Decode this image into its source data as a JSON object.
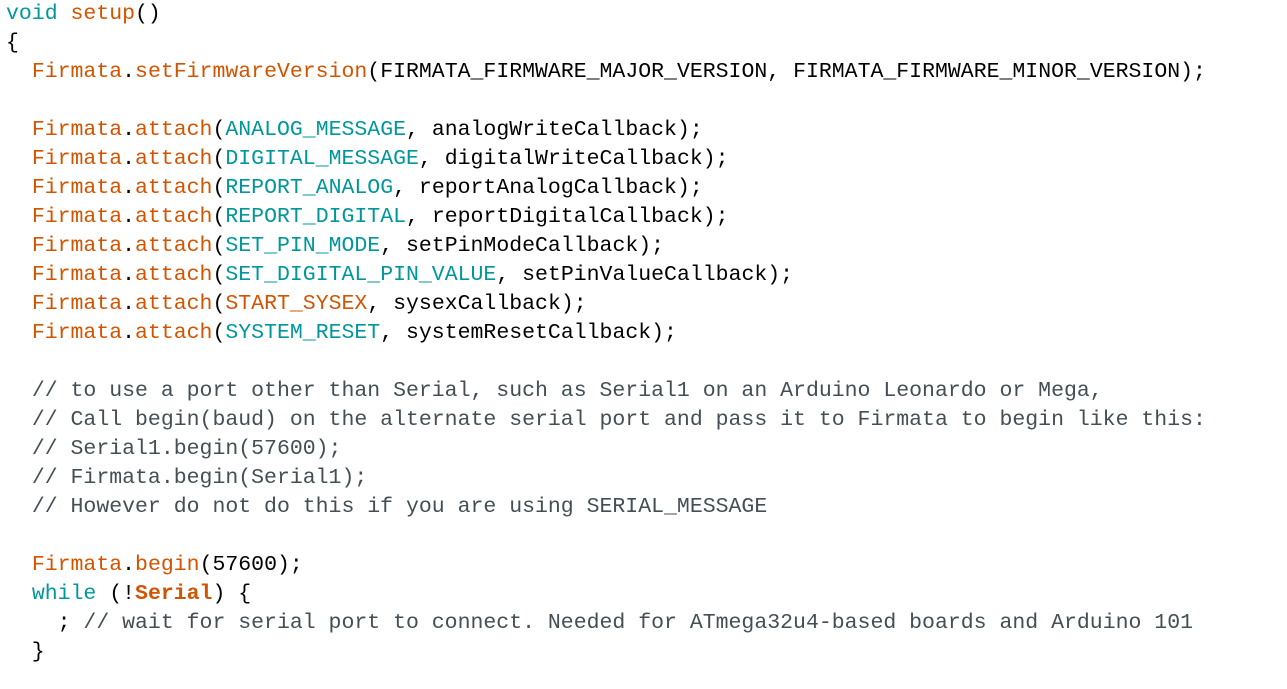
{
  "colors": {
    "background": "#ffffff",
    "text": "#000000",
    "keyword": "#00979C",
    "function": "#D35400",
    "constant": "#00979C",
    "comment": "#434F54"
  },
  "code_lines": [
    [
      {
        "t": "void",
        "c": "keyword"
      },
      {
        "t": " "
      },
      {
        "t": "setup",
        "c": "func"
      },
      {
        "t": "()"
      }
    ],
    [
      {
        "t": "{"
      }
    ],
    [
      {
        "t": "  "
      },
      {
        "t": "Firmata",
        "c": "func"
      },
      {
        "t": "."
      },
      {
        "t": "setFirmwareVersion",
        "c": "func"
      },
      {
        "t": "(FIRMATA_FIRMWARE_MAJOR_VERSION, FIRMATA_FIRMWARE_MINOR_VERSION);"
      }
    ],
    [],
    [
      {
        "t": "  "
      },
      {
        "t": "Firmata",
        "c": "func"
      },
      {
        "t": "."
      },
      {
        "t": "attach",
        "c": "func"
      },
      {
        "t": "("
      },
      {
        "t": "ANALOG_MESSAGE",
        "c": "const"
      },
      {
        "t": ", analogWriteCallback);"
      }
    ],
    [
      {
        "t": "  "
      },
      {
        "t": "Firmata",
        "c": "func"
      },
      {
        "t": "."
      },
      {
        "t": "attach",
        "c": "func"
      },
      {
        "t": "("
      },
      {
        "t": "DIGITAL_MESSAGE",
        "c": "const"
      },
      {
        "t": ", digitalWriteCallback);"
      }
    ],
    [
      {
        "t": "  "
      },
      {
        "t": "Firmata",
        "c": "func"
      },
      {
        "t": "."
      },
      {
        "t": "attach",
        "c": "func"
      },
      {
        "t": "("
      },
      {
        "t": "REPORT_ANALOG",
        "c": "const"
      },
      {
        "t": ", reportAnalogCallback);"
      }
    ],
    [
      {
        "t": "  "
      },
      {
        "t": "Firmata",
        "c": "func"
      },
      {
        "t": "."
      },
      {
        "t": "attach",
        "c": "func"
      },
      {
        "t": "("
      },
      {
        "t": "REPORT_DIGITAL",
        "c": "const"
      },
      {
        "t": ", reportDigitalCallback);"
      }
    ],
    [
      {
        "t": "  "
      },
      {
        "t": "Firmata",
        "c": "func"
      },
      {
        "t": "."
      },
      {
        "t": "attach",
        "c": "func"
      },
      {
        "t": "("
      },
      {
        "t": "SET_PIN_MODE",
        "c": "const"
      },
      {
        "t": ", setPinModeCallback);"
      }
    ],
    [
      {
        "t": "  "
      },
      {
        "t": "Firmata",
        "c": "func"
      },
      {
        "t": "."
      },
      {
        "t": "attach",
        "c": "func"
      },
      {
        "t": "("
      },
      {
        "t": "SET_DIGITAL_PIN_VALUE",
        "c": "const"
      },
      {
        "t": ", setPinValueCallback);"
      }
    ],
    [
      {
        "t": "  "
      },
      {
        "t": "Firmata",
        "c": "func"
      },
      {
        "t": "."
      },
      {
        "t": "attach",
        "c": "func"
      },
      {
        "t": "("
      },
      {
        "t": "START_SYSEX",
        "c": "func"
      },
      {
        "t": ", sysexCallback);"
      }
    ],
    [
      {
        "t": "  "
      },
      {
        "t": "Firmata",
        "c": "func"
      },
      {
        "t": "."
      },
      {
        "t": "attach",
        "c": "func"
      },
      {
        "t": "("
      },
      {
        "t": "SYSTEM_RESET",
        "c": "const"
      },
      {
        "t": ", systemResetCallback);"
      }
    ],
    [],
    [
      {
        "t": "  "
      },
      {
        "t": "// to use a port other than Serial, such as Serial1 on an Arduino Leonardo or Mega,",
        "c": "comment"
      }
    ],
    [
      {
        "t": "  "
      },
      {
        "t": "// Call begin(baud) on the alternate serial port and pass it to Firmata to begin like this:",
        "c": "comment"
      }
    ],
    [
      {
        "t": "  "
      },
      {
        "t": "// Serial1.begin(57600);",
        "c": "comment"
      }
    ],
    [
      {
        "t": "  "
      },
      {
        "t": "// Firmata.begin(Serial1);",
        "c": "comment"
      }
    ],
    [
      {
        "t": "  "
      },
      {
        "t": "// However do not do this if you are using SERIAL_MESSAGE",
        "c": "comment"
      }
    ],
    [],
    [
      {
        "t": "  "
      },
      {
        "t": "Firmata",
        "c": "func"
      },
      {
        "t": "."
      },
      {
        "t": "begin",
        "c": "func"
      },
      {
        "t": "(57600);"
      }
    ],
    [
      {
        "t": "  "
      },
      {
        "t": "while",
        "c": "keyword"
      },
      {
        "t": " (!"
      },
      {
        "t": "Serial",
        "c": "bold-class"
      },
      {
        "t": ") {"
      }
    ],
    [
      {
        "t": "    ; "
      },
      {
        "t": "// wait for serial port to connect. Needed for ATmega32u4-based boards and Arduino 101",
        "c": "comment"
      }
    ],
    [
      {
        "t": "  }"
      }
    ]
  ]
}
